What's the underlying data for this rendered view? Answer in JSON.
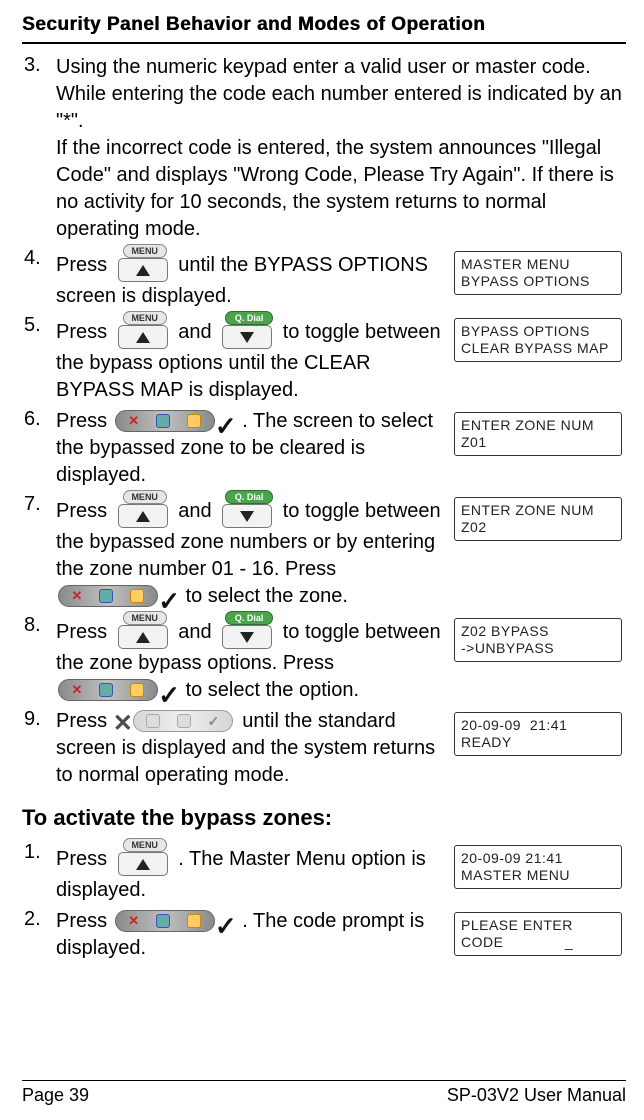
{
  "header": "Security Panel Behavior and Modes of Operation",
  "items3to9": [
    {
      "n": "3.",
      "text1": "Using the numeric keypad enter a valid user or master code. While entering the code each number entered is indicated by an \"*\".",
      "text2": "If the incorrect code is entered, the system announces \"Illegal Code\" and displays \"Wrong Code, Please Try Again\". If there is no activity for 10 seconds, the system returns to normal operating mode."
    }
  ],
  "step4": {
    "n": "4.",
    "pre": "Press ",
    "post": " until the BYPASS OPTIONS screen is displayed.",
    "screen1": "MASTER MENU",
    "screen2": "BYPASS OPTIONS"
  },
  "step5": {
    "n": "5.",
    "pre": "Press ",
    "mid": " and ",
    "post": " to toggle between the bypass options until the CLEAR BYPASS MAP is displayed.",
    "screen1": "BYPASS OPTIONS",
    "screen2": "CLEAR BYPASS MAP"
  },
  "step6": {
    "n": "6.",
    "pre": "Press ",
    "post": ". The screen to select the bypassed zone to be cleared is displayed.",
    "screen1": "ENTER ZONE NUM",
    "screen2": "Z01"
  },
  "step7": {
    "n": "7.",
    "pre": "Press ",
    "mid": " and ",
    "post1": " to toggle between the bypassed zone numbers or by entering the zone number 01 - 16. Press ",
    "post2": " to select the zone.",
    "screen1": "ENTER ZONE NUM",
    "screen2": "Z02"
  },
  "step8": {
    "n": "8.",
    "pre": "Press ",
    "mid": " and ",
    "post1": " to toggle between the zone bypass options. Press ",
    "post2": " to select the option.",
    "screen1": "Z02 BYPASS",
    "screen2": "->UNBYPASS"
  },
  "step9": {
    "n": "9.",
    "pre": "Press ",
    "post": " until the standard screen is displayed and the system returns to normal operating mode.",
    "screen1": "20-09-09  21:41",
    "screen2": "READY"
  },
  "sectionTitle": "To activate the bypass zones:",
  "stepA1": {
    "n": "1.",
    "pre": "Press ",
    "post": ". The Master Menu option is displayed.",
    "screen1": "20-09-09 21:41",
    "screen2": "MASTER MENU"
  },
  "stepA2": {
    "n": "2.",
    "pre": "Press ",
    "post": ". The code prompt is displayed.",
    "screen1": "PLEASE ENTER",
    "screen2": "CODE              _"
  },
  "footer": {
    "left": "Page 39",
    "right": "SP-03V2 User Manual"
  },
  "icons": {
    "menu": "MENU",
    "qdial": "Q. Dial"
  }
}
